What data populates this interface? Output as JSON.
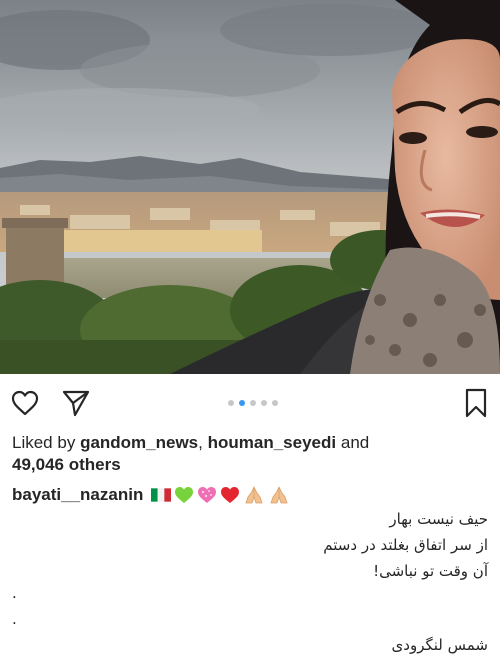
{
  "post": {
    "carousel": {
      "count": 5,
      "active_index": 1
    },
    "icons": {
      "like": "heart-outline-icon",
      "share": "paper-plane-icon",
      "save": "bookmark-icon"
    },
    "likes": {
      "prefix": "Liked by",
      "user1": "gandom_news",
      "separator": ",",
      "user2": "houman_seyedi",
      "conjunction": "and",
      "others": "49,046 others"
    },
    "caption": {
      "username": "bayati__nazanin",
      "emojis": [
        "italy-flag-icon",
        "green-heart-icon",
        "sparkling-heart-icon",
        "red-heart-icon",
        "folded-hands-icon",
        "folded-hands-icon"
      ],
      "lines": [
        "حیف نیست بهار",
        "از سر اتفاق بغلتد در دستم",
        "آن وقت تو نباشی!",
        ".",
        ".",
        "شمس لنگرودی"
      ]
    },
    "colors": {
      "text": "#262626",
      "dot_active": "#3897f0",
      "dot_inactive": "#c7c7c7"
    }
  }
}
